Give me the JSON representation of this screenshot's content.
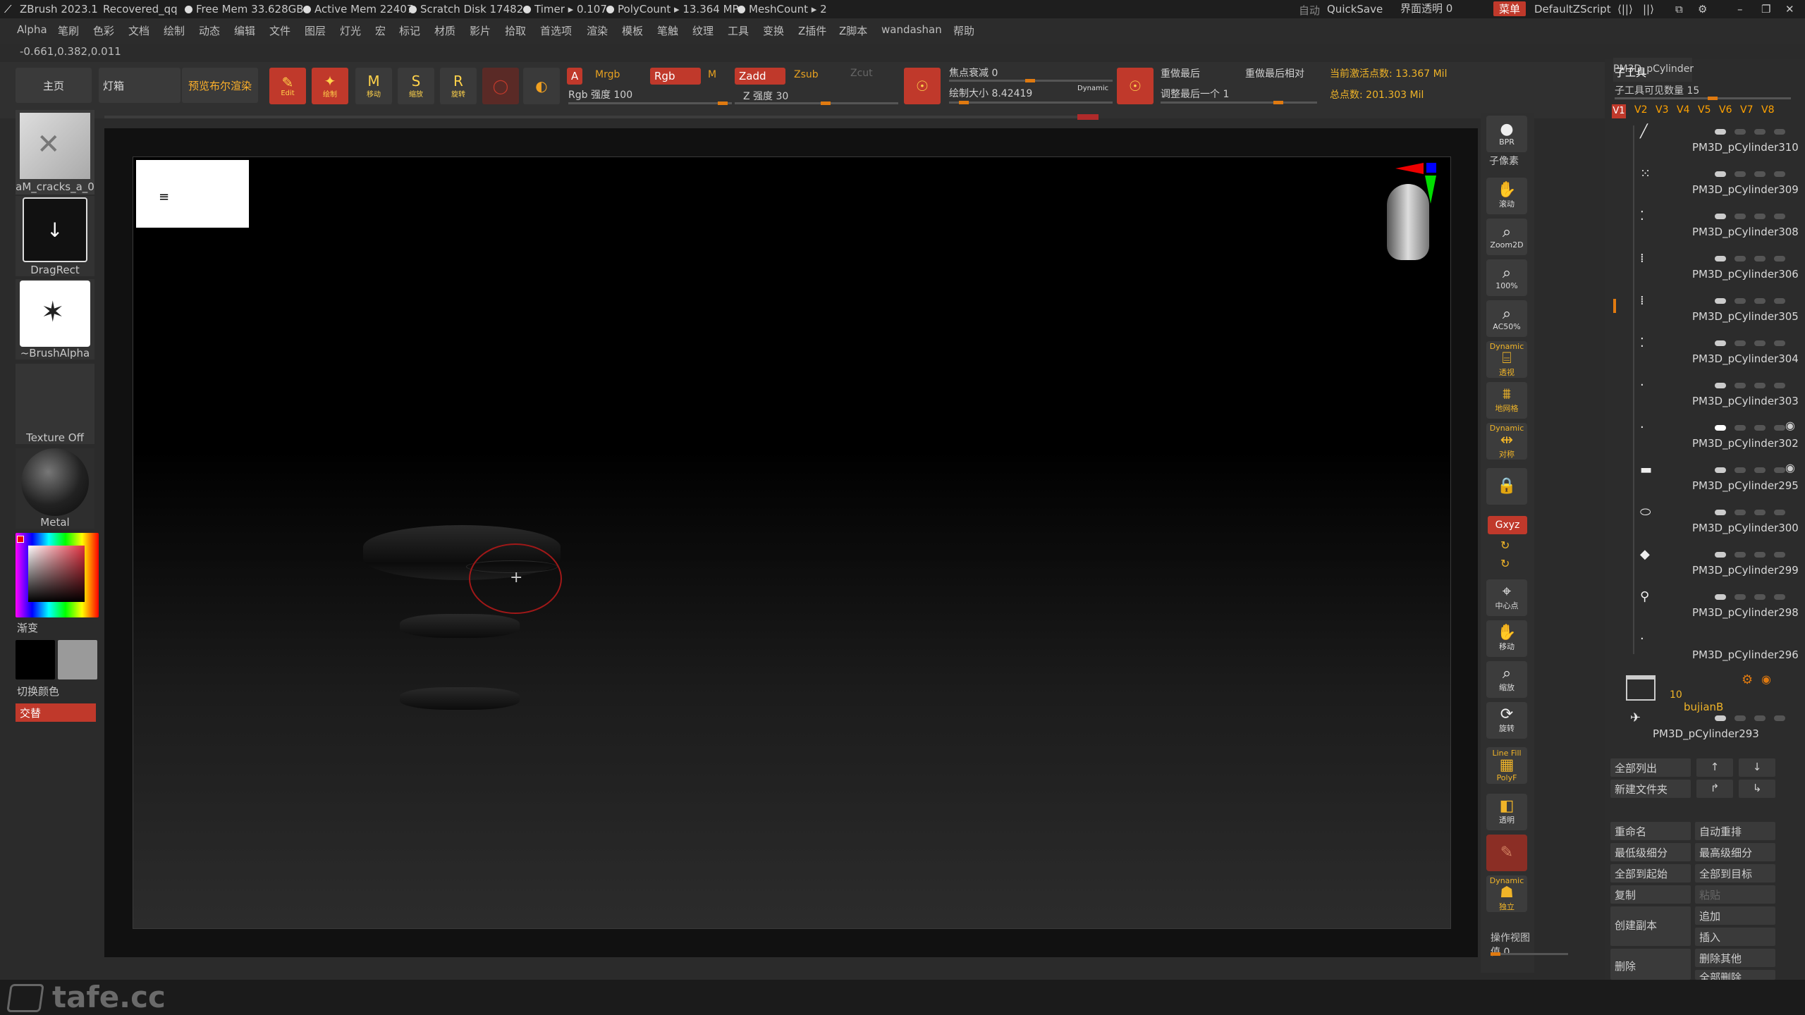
{
  "titlebar": {
    "app": "ZBrush 2023.1",
    "file": "Recovered_qq",
    "free_mem": "Free Mem 33.628GB",
    "active_mem": "Active Mem 22407",
    "scratch": "Scratch Disk 17482",
    "timer": "Timer ▸ 0.107",
    "polycount": "PolyCount ▸ 13.364 MP",
    "meshcount": "MeshCount ▸ 2",
    "auto": "自动",
    "quicksave": "QuickSave",
    "ui_opacity": "界面透明 0",
    "menu": "菜单",
    "script": "DefaultZScript"
  },
  "menubar": [
    "Alpha",
    "笔刷",
    "色彩",
    "文档",
    "绘制",
    "动态",
    "编辑",
    "文件",
    "图层",
    "灯光",
    "宏",
    "标记",
    "材质",
    "影片",
    "拾取",
    "首选项",
    "渲染",
    "模板",
    "笔触",
    "纹理",
    "工具",
    "变换",
    "Z插件",
    "Z脚本",
    "wandashan",
    "帮助"
  ],
  "coords": "-0.661,0.382,0.011",
  "toolrow": {
    "home": "主页",
    "lightbox": "灯箱",
    "bpr_preview": "预览布尔渲染",
    "edit": "Edit",
    "draw": "绘制",
    "move": "移动",
    "scale": "缩放",
    "rotate": "旋转",
    "A": "A",
    "mrgb": "Mrgb",
    "rgb": "Rgb",
    "M": "M",
    "rgb_intensity": "Rgb 强度 100",
    "zadd": "Zadd",
    "zsub": "Zsub",
    "zcut": "Zcut",
    "z_intensity": "Z 强度 30",
    "focal": "焦点衰减 0",
    "draw_size": "绘制大小 8.42419",
    "dynamic": "Dynamic",
    "redo_last": "重做最后",
    "redo_last_rel": "重做最后相对",
    "adjust_last": "调整最后一个 1",
    "active_points": "当前激活点数: 13.367 Mil",
    "total_points": "总点数: 201.303 Mil"
  },
  "left": {
    "alpha_label": "aM_cracks_a_0",
    "stroke_label": "DragRect",
    "brush_alpha": "~BrushAlpha",
    "texture": "Texture Off",
    "material": "Metal",
    "gradient": "渐变",
    "switch_color": "切换颜色",
    "alternate": "交替"
  },
  "shelf": {
    "bpr": "BPR",
    "subpixel": "子像素",
    "scroll": "滚动",
    "zoom2d": "Zoom2D",
    "p100": "100%",
    "ac50": "AC50%",
    "persp": "透视",
    "floor": "地网格",
    "sym": "对称",
    "lock": "锁定",
    "xyz": "Gxyz",
    "frame": "中心点",
    "move": "移动",
    "zoom": "缩放",
    "rotate": "旋转",
    "polyf": "PolyF",
    "transp": "透明",
    "ghost": "幽灵",
    "solo": "独立",
    "linefill": "Line Fill",
    "dynamic": "Dynamic",
    "op_view": "操作视图值 0"
  },
  "subtool": {
    "top_name": "PM3D_pCylinder",
    "header": "子工具",
    "visible": "子工具可见数量 15",
    "versions": [
      "V1",
      "V2",
      "V3",
      "V4",
      "V5",
      "V6",
      "V7",
      "V8"
    ],
    "items": [
      "PM3D_pCylinder310",
      "PM3D_pCylinder309",
      "PM3D_pCylinder308",
      "PM3D_pCylinder306",
      "PM3D_pCylinder305",
      "PM3D_pCylinder304",
      "PM3D_pCylinder303",
      "PM3D_pCylinder302",
      "PM3D_pCylinder295",
      "PM3D_pCylinder300",
      "PM3D_pCylinder299",
      "PM3D_pCylinder298",
      "PM3D_pCylinder296"
    ],
    "folder_count": "10",
    "folder_name": "bujianB",
    "last_item": "PM3D_pCylinder293",
    "list_all": "全部列出",
    "new_folder": "新建文件夹",
    "rename": "重命名",
    "auto_reorder": "自动重排",
    "lowest_sub": "最低级细分",
    "highest_sub": "最高级细分",
    "all_to_start": "全部到起始",
    "all_to_target": "全部到目标",
    "copy": "复制",
    "paste": "粘贴",
    "create_copy": "创建副本",
    "append": "追加",
    "insert": "插入",
    "delete": "删除",
    "delete_other": "删除其他",
    "delete_all": "全部删除"
  },
  "watermark": "tafe.cc"
}
